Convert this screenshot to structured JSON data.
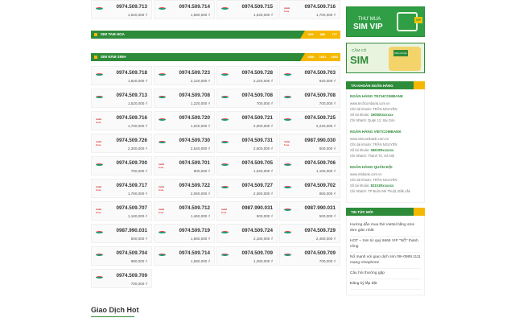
{
  "top_cards": [
    {
      "carrier": "viettel",
      "number": "0974.509.713",
      "price": "1,520,000 ₫"
    },
    {
      "carrier": "viettel",
      "number": "0974.509.714",
      "price": "1,580,000 ₫"
    },
    {
      "carrier": "viettel",
      "number": "0974.509.715",
      "price": "1,640,000 ₫"
    },
    {
      "carrier": "mobifone",
      "number": "0974.509.716",
      "price": "1,700,000 ₫"
    }
  ],
  "section_tam_hoa": {
    "label": "SIM TAM HOA",
    "tabs": [
      "999",
      "888",
      "777"
    ]
  },
  "section_nam_sinh": {
    "label": "SIM NĂM SINH",
    "tabs": [
      "1990",
      "1991",
      "1992"
    ]
  },
  "cards": [
    {
      "carrier": "viettel",
      "number": "0974.509.718",
      "price": "1,820,000 ₫"
    },
    {
      "carrier": "viettel",
      "number": "0974.509.723",
      "price": "2,120,000 ₫"
    },
    {
      "carrier": "viettel",
      "number": "0974.509.728",
      "price": "2,420,000 ₫"
    },
    {
      "carrier": "viettel",
      "number": "0974.509.703",
      "price": "920,000 ₫"
    },
    {
      "carrier": "viettel",
      "number": "0974.509.713",
      "price": "1,520,000 ₫"
    },
    {
      "carrier": "viettel",
      "number": "0974.509.708",
      "price": "1,220,000 ₫"
    },
    {
      "carrier": "viettel",
      "number": "0974.509.708",
      "price": "700,000 ₫"
    },
    {
      "carrier": "viettel",
      "number": "0974.509.708",
      "price": "700,000 ₫"
    },
    {
      "carrier": "mobifone",
      "number": "0974.509.716",
      "price": "1,700,000 ₫"
    },
    {
      "carrier": "viettel",
      "number": "0974.509.720",
      "price": "1,940,000 ₫"
    },
    {
      "carrier": "viettel",
      "number": "0974.509.721",
      "price": "2,000,000 ₫"
    },
    {
      "carrier": "viettel",
      "number": "0974.509.725",
      "price": "2,240,000 ₫"
    },
    {
      "carrier": "mobifone",
      "number": "0974.509.726",
      "price": "2,300,000 ₫"
    },
    {
      "carrier": "viettel",
      "number": "0974.509.730",
      "price": "2,540,000 ₫"
    },
    {
      "carrier": "viettel",
      "number": "0974.509.731",
      "price": "2,600,000 ₫"
    },
    {
      "carrier": "mobifone",
      "number": "0987.990.030",
      "price": "500,000 ₫"
    },
    {
      "carrier": "viettel",
      "number": "0974.509.700",
      "price": "700,000 ₫"
    },
    {
      "carrier": "mobifone",
      "number": "0974.509.701",
      "price": "800,000 ₫"
    },
    {
      "carrier": "viettel",
      "number": "0974.509.705",
      "price": "1,040,000 ₫"
    },
    {
      "carrier": "viettel",
      "number": "0974.509.706",
      "price": "1,100,000 ₫"
    },
    {
      "carrier": "mobifone",
      "number": "0974.509.717",
      "price": "1,760,000 ₫"
    },
    {
      "carrier": "mobifone",
      "number": "0974.509.722",
      "price": "2,060,000 ₫"
    },
    {
      "carrier": "viettel",
      "number": "0974.509.727",
      "price": "2,360,000 ₫"
    },
    {
      "carrier": "viettel",
      "number": "0974.509.702",
      "price": "860,000 ₫"
    },
    {
      "carrier": "mobifone",
      "number": "0974.509.707",
      "price": "1,160,000 ₫"
    },
    {
      "carrier": "mobifone",
      "number": "0974.509.712",
      "price": "1,460,000 ₫"
    },
    {
      "carrier": "mobifone",
      "number": "0987.990.031",
      "price": "500,000 ₫"
    },
    {
      "carrier": "viettel",
      "number": "0987.990.031",
      "price": "500,000 ₫"
    },
    {
      "carrier": "viettel",
      "number": "0987.990.031",
      "price": "500,000 ₫"
    },
    {
      "carrier": "viettel",
      "number": "0974.509.719",
      "price": "1,880,000 ₫"
    },
    {
      "carrier": "viettel",
      "number": "0974.509.724",
      "price": "2,180,000 ₫"
    },
    {
      "carrier": "viettel",
      "number": "0974.509.729",
      "price": "2,480,000 ₫"
    },
    {
      "carrier": "viettel",
      "number": "0974.509.704",
      "price": "980,000 ₫"
    },
    {
      "carrier": "viettel",
      "number": "0974.509.714",
      "price": "1,580,000 ₫"
    },
    {
      "carrier": "viettel",
      "number": "0974.509.709",
      "price": "1,280,000 ₫"
    },
    {
      "carrier": "viettel",
      "number": "0974.509.709",
      "price": "700,000 ₫"
    },
    {
      "carrier": "viettel",
      "number": "0974.509.709",
      "price": "700,000 ₫"
    }
  ],
  "transactions_heading": "Giao Dịch Hot",
  "banner_vip": {
    "line1": "THƯ MUA",
    "line2": "SIM VIP",
    "tag": "VIP"
  },
  "banner_camco": {
    "line1": "CẦM CỐ",
    "line2": "SIM",
    "tag": "Cầm cố sim"
  },
  "bank_section": {
    "title": "TÀI KHOẢN NGÂN HÀNG",
    "banks": [
      {
        "name": "NGÂN HÀNG TECHCOMBANK",
        "site": "www.techcombank.com.vn",
        "owner": "Chủ tài khoản: TRẦN NGUYÊN",
        "account_label": "Số tài khoản:",
        "account": "190000xxxxxx",
        "branch": "Chi Nhánh: Quận 12, Sài Gòn"
      },
      {
        "name": "NGÂN HÀNG VIETCOMBANK",
        "site": "www.vietcombank.com.vn",
        "owner": "Chủ tài khoản: TRẦN NGUYÊN",
        "account_label": "Số tài khoản:",
        "account": "06910Rxxxxxx",
        "branch": "Chi Nhánh: Thanh Trì, Hà Nội"
      },
      {
        "name": "NGÂN HÀNG QUÂN ĐỘI",
        "site": "www.mbbank.com.vn",
        "owner": "Chủ tài khoản: TRẦN NGUYÊN",
        "account_label": "Số tài khoản:",
        "account": "82101Rxxxxxx",
        "branch": "Chi Nhánh: TP Buôn Mê Thuột, Đắk Lắk"
      }
    ]
  },
  "news_section": {
    "title": "TIN TỨC MỚI",
    "items": [
      "Hướng dẫn mua thẻ Viettel bằng sms đơn giản nhất",
      "HOT – Sim tứ quý 6666 VIP \"NỔ\" thành công",
      "Nổ mạnh với giao dịch sim 09+0989.1111 mạng Vinaphone",
      "Câu hỏi thường gặp",
      "Đăng ký lắp đặt"
    ]
  }
}
